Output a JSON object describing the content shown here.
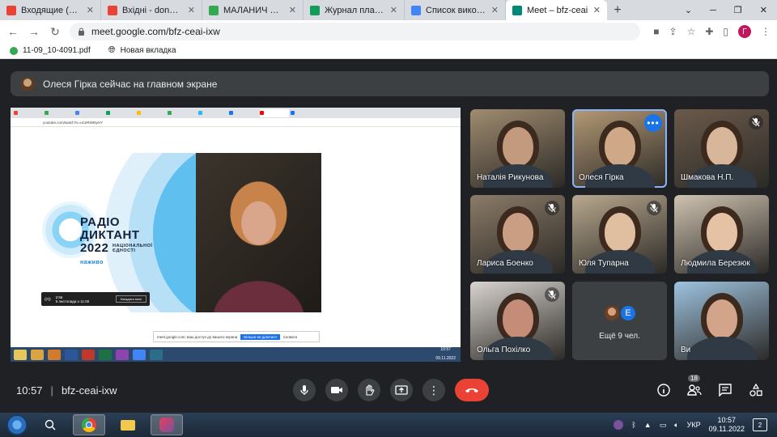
{
  "browser": {
    "tabs": [
      {
        "label": "Входящие (473) - ",
        "color": "#ea4335",
        "active": false
      },
      {
        "label": "Вхідні - donoenc@",
        "color": "#ea4335",
        "active": false
      },
      {
        "label": "МАЛАНИЧ О.Б - G",
        "color": "#34a853",
        "active": false
      },
      {
        "label": "Журнал планування",
        "color": "#0f9d58",
        "active": false
      },
      {
        "label": "Список виконавців",
        "color": "#4285f4",
        "active": false
      },
      {
        "label": "Meet – bfz-ceai",
        "color": "#00897b",
        "active": true
      }
    ],
    "url": "meet.google.com/bfz-ceai-ixw",
    "profile_initial": "Г",
    "bookmarks": [
      {
        "label": "11-09_10-4091.pdf"
      },
      {
        "label": "Новая вкладка"
      }
    ]
  },
  "meet": {
    "presenter_banner": "Олеся Гірка сейчас на главном экране",
    "shared_screen": {
      "inner_address": "youtube.com/watch?v=uCeRWI5yHY",
      "title_line1": "РАДІО",
      "title_line2": "ДИКТАНТ",
      "title_year": "2022",
      "title_sub": "НАЦІОНАЛЬНОЇ ЄДНОСТІ",
      "title_live": "наживо",
      "player_time": "2:56",
      "player_status": "9 листопада о 11:00",
      "player_button": "Нагадати мені",
      "share_text": "meet.google.com: ваш доступ до вашого екрана",
      "share_stop": "Більше не ділитися",
      "share_hide": "Сховати",
      "inner_clock_time": "10:57",
      "inner_clock_date": "09.11.2022"
    },
    "participants": [
      {
        "name": "Наталія Рикунова",
        "muted": false,
        "bg": "#a08c70",
        "face": "#c49a7e"
      },
      {
        "name": "Олеся Гірка",
        "muted": false,
        "bg": "#b59a76",
        "face": "#cfa888",
        "highlight": true
      },
      {
        "name": "Шмакова Н.П.",
        "muted": true,
        "bg": "#6b5a4a",
        "face": "#d8b69a"
      },
      {
        "name": "Лариса Боенко",
        "muted": true,
        "bg": "#8b7b68",
        "face": "#c99e82"
      },
      {
        "name": "Юля Тупарна",
        "muted": true,
        "bg": "#b8a88e",
        "face": "#e0bfa1"
      },
      {
        "name": "Людмила Березюк",
        "muted": false,
        "bg": "#cfc3b1",
        "face": "#e6c2a4"
      },
      {
        "name": "Ольга Похілко",
        "muted": true,
        "bg": "#d9d4cf",
        "face": "#c58d78"
      },
      {
        "name": "Ви",
        "muted": false,
        "bg": "#9ec3df",
        "face": "#d2a48a"
      }
    ],
    "more_label": "Ещё 9 чел.",
    "more_initial": "E",
    "meeting_time": "10:57",
    "meeting_code": "bfz-ceai-ixw",
    "people_count": "18"
  },
  "os": {
    "lang": "УКР",
    "time": "10:57",
    "date": "09.11.2022",
    "notifications": "2"
  }
}
